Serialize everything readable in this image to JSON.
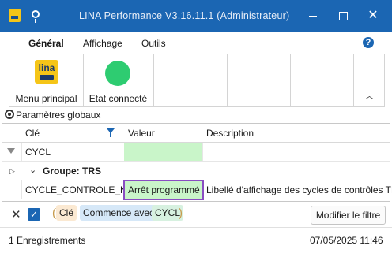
{
  "window": {
    "title": "LINA Performance  V3.16.11.1  (Administrateur)",
    "controls": [
      "minimize-icon",
      "maximize-icon",
      "close-icon"
    ]
  },
  "ribbon": {
    "tabs": [
      {
        "label": "Général",
        "active": true
      },
      {
        "label": "Affichage",
        "active": false
      },
      {
        "label": "Outils",
        "active": false
      }
    ],
    "help_label": "?",
    "logo_text": "lina",
    "buttons": [
      {
        "label": "Menu principal",
        "icon": "lina-logo-icon"
      },
      {
        "label": "Etat connecté",
        "icon": "status-dot-icon",
        "color": "#2ecc71"
      }
    ],
    "collapse_label": "^"
  },
  "params": {
    "label": "Paramètres globaux"
  },
  "grid": {
    "columns": [
      "Clé",
      "Valeur",
      "Description"
    ],
    "filter_row": {
      "cle": "CYCL",
      "valeur": ""
    },
    "group": {
      "label": "Groupe: TRS"
    },
    "rows": [
      {
        "cle": "CYCLE_CONTROLE_NOM",
        "valeur": "Arrêt programmé",
        "description": "Libellé d'affichage des cycles de contrôles TRS"
      }
    ]
  },
  "filter": {
    "field": "Clé",
    "operator": "Commence avec",
    "value": "CYCL",
    "modify_label": "Modifier le filtre",
    "paren_open": "(",
    "paren_close": ")"
  },
  "status": {
    "records": "1 Enregistrements",
    "datetime": "07/05/2025 11:46"
  },
  "colors": {
    "accent": "#1b66b3",
    "filter_cell": "#c9f5c9",
    "selection_outline": "#8a4ec2",
    "status_ok": "#2ecc71"
  }
}
